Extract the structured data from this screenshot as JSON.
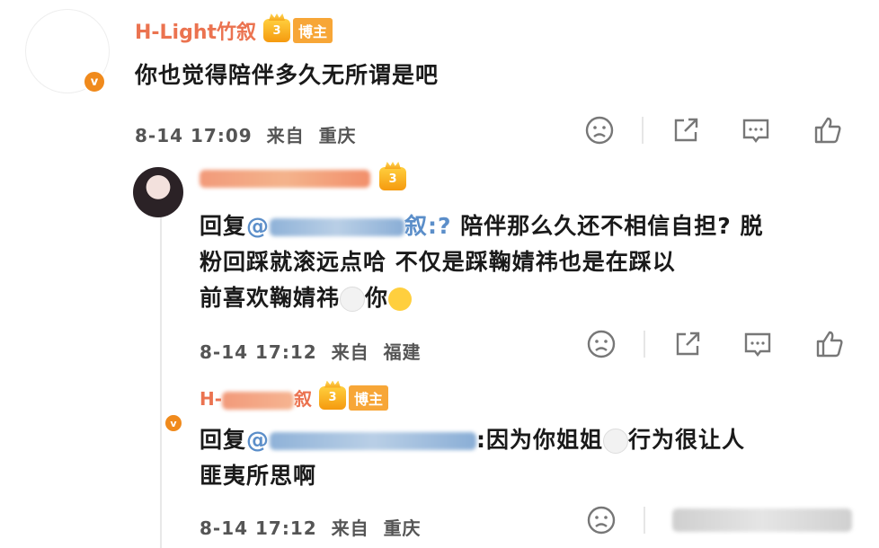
{
  "comment": {
    "username": "H-Light竹叙",
    "badge_label": "博主",
    "text": "你也觉得陪伴多久无所谓是吧",
    "time": "8-14 17:09",
    "from_label": "来自",
    "location": "重庆"
  },
  "reply1": {
    "reply_prefix": "回复",
    "mention_prefix": "@",
    "mention_suffix": "叙:?",
    "line1_rest": "陪伴那么久还不相信自担? 脱",
    "line2": "粉回踩就滚远点哈 不仅是踩鞠婧祎也是在踩以",
    "line3": "前喜欢鞠婧祎",
    "line3_end": "你",
    "time": "8-14 17:12",
    "from_label": "来自",
    "location": "福建"
  },
  "reply2": {
    "username_prefix": "H-",
    "username_suffix": "叙",
    "badge_label": "博主",
    "reply_prefix": "回复",
    "mention_prefix": "@",
    "line1_rest": ":因为你姐姐",
    "line1_end": "行为很让人",
    "line2": "匪夷所思啊",
    "time": "8-14 17:12",
    "from_label": "来自",
    "location": "重庆"
  },
  "icons": [
    "dislike-icon",
    "share-icon",
    "comment-icon",
    "like-icon"
  ],
  "colors": {
    "username": "#eb7350",
    "mention": "#5b8ec9",
    "badge": "#f7a637",
    "verified": "#f08a1c"
  }
}
